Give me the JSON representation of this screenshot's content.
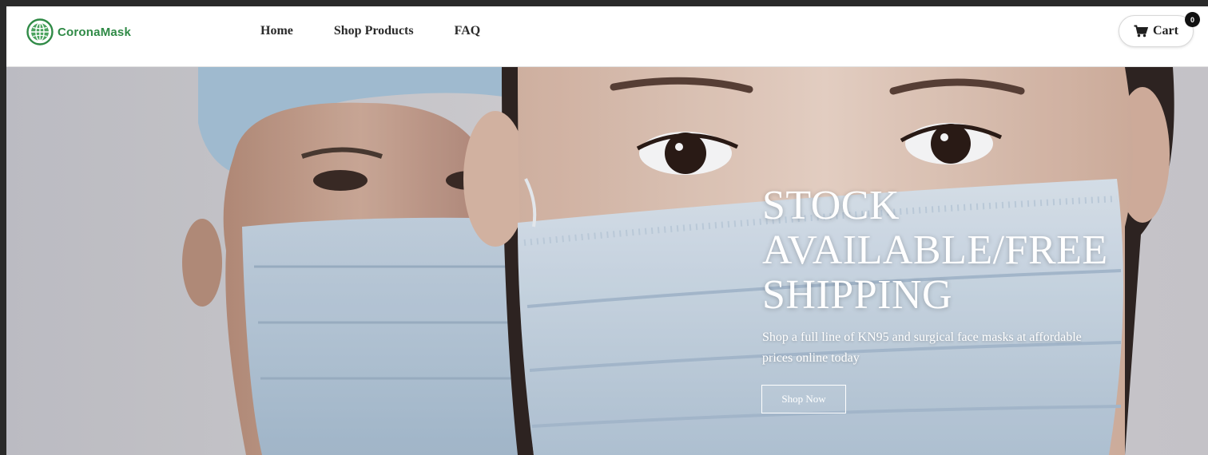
{
  "brand": {
    "name": "CoronaMask",
    "color": "#2f8a46"
  },
  "nav": {
    "links": [
      "Home",
      "Shop Products",
      "FAQ"
    ]
  },
  "cart": {
    "label": "Cart",
    "count": "0",
    "icon": "shopping-cart-icon"
  },
  "hero": {
    "title": "STOCK AVAILABLE/FREE SHIPPING",
    "subtitle": "Shop a full line of KN95 and surgical face masks at affordable prices online today",
    "button_label": "Shop Now"
  }
}
